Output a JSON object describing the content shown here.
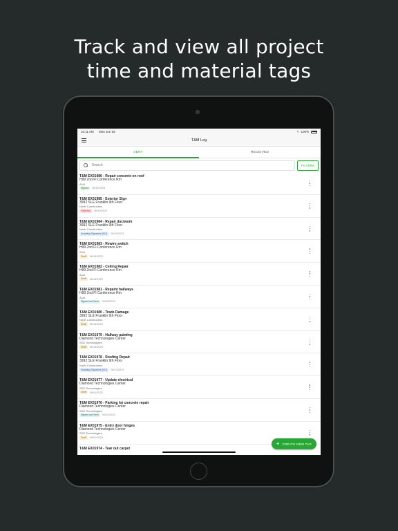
{
  "headline": [
    "Track and view all project",
    "time and material tags"
  ],
  "status": {
    "time": "10:11 AM",
    "date": "Mon Jun 19",
    "battery": "100%"
  },
  "appbar": {
    "title": "T&M Log"
  },
  "tabs": [
    "SENT",
    "RECEIVED"
  ],
  "search": {
    "placeholder": "Search",
    "filters_label": "FILTERS"
  },
  "items": [
    {
      "title": "T&M EX01986 - Repair concrete on roof",
      "location": "H99 2nd Fl Conference Rm",
      "company": "AUA",
      "badge": "Signed",
      "badge_type": "signed",
      "date": "06/19/2023"
    },
    {
      "title": "T&M EX01985 - Exterior Sign",
      "location": "3992 SLE Franklin 9th Floor",
      "company": "North Construction",
      "badge": "Rejected",
      "badge_type": "rejected",
      "date": "06/19/2023"
    },
    {
      "title": "T&M EX01984 - Repair ductwork",
      "location": "3992 SLE Franklin 9th Floor",
      "company": "North Construction",
      "badge": "Awaiting Signature (0/1)",
      "badge_type": "await",
      "date": "06/19/2023"
    },
    {
      "title": "T&M EX01983 - Rewire switch",
      "location": "H99 2nd Fl Conference Rm",
      "company": "AUA",
      "badge": "Draft",
      "badge_type": "draft",
      "date": "06/16/2023"
    },
    {
      "title": "T&M EX01982 - Ceiling Repair",
      "location": "H99 2nd Fl Conference Rm",
      "company": "AUA",
      "badge": "Draft",
      "badge_type": "draft",
      "date": "06/16/2023"
    },
    {
      "title": "T&M EX01981 - Repaint hallways",
      "location": "H99 2nd Fl Conference Rm",
      "company": "AUA",
      "badge": "Signed not Sent",
      "badge_type": "signedns",
      "date": "06/16/2023"
    },
    {
      "title": "T&M EX01980 - Trade Damage",
      "location": "3992 SLE Franklin 9th Floor",
      "company": "North Construction",
      "badge": "Draft",
      "badge_type": "draft",
      "date": "06/14/2023"
    },
    {
      "title": "T&M EX01979 - Hallway painting",
      "location": "Diamond Technologies Center",
      "company": "SKD Technologies",
      "badge": "Draft",
      "badge_type": "draft",
      "date": "06/14/2023"
    },
    {
      "title": "T&M EX01978 - Roofing Repair",
      "location": "3992 SLE Franklin 9th Floor",
      "company": "North Construction",
      "badge": "Awaiting Signature (0/1)",
      "badge_type": "await",
      "date": "06/13/2023"
    },
    {
      "title": "T&M EX01977 - Update electrical",
      "location": "Diamond Technologies Center",
      "company": "SKD Technologies",
      "badge": "Draft",
      "badge_type": "draft",
      "date": "06/01/2023"
    },
    {
      "title": "T&M EX01976 - Parking lot concrete repair",
      "location": "Diamond Technologies Center",
      "company": "SKD Technologies",
      "badge": "Signed not Sent",
      "badge_type": "signedns",
      "date": "06/01/2023"
    },
    {
      "title": "T&M EX01975 - Entry door hinges",
      "location": "Diamond Technologies Center",
      "company": "SKD Technologies",
      "badge": "Draft",
      "badge_type": "draft",
      "date": "06/01/2023"
    },
    {
      "title": "T&M EX01974 - Tear out carpet",
      "location": "",
      "company": "",
      "badge": "",
      "badge_type": "",
      "date": ""
    }
  ],
  "fab": {
    "label": "CREATE NEW TAG"
  },
  "colors": {
    "accent": "#2aa636",
    "background": "#252b2b"
  }
}
